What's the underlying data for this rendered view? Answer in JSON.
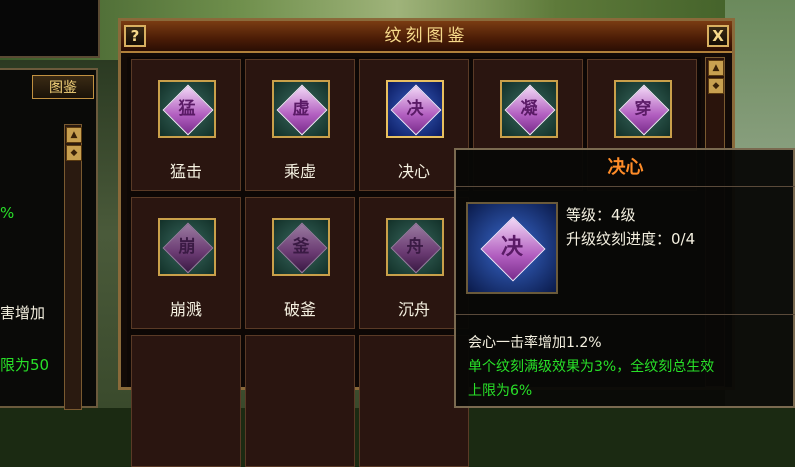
{
  "left_panel": {
    "tab_label": "图鉴",
    "text_percent": "%",
    "text_damage": "害增加",
    "text_limit": "限为50"
  },
  "window": {
    "title": "纹刻图鉴",
    "help_label": "?",
    "close_label": "X"
  },
  "cells": [
    {
      "label": "猛击",
      "glyph": "猛"
    },
    {
      "label": "乘虚",
      "glyph": "虚"
    },
    {
      "label": "决心",
      "glyph": "决"
    },
    {
      "label": "",
      "glyph": "凝"
    },
    {
      "label": "",
      "glyph": "穿"
    },
    {
      "label": "崩溅",
      "glyph": "崩"
    },
    {
      "label": "破釜",
      "glyph": "釜"
    },
    {
      "label": "沉舟",
      "glyph": "舟"
    }
  ],
  "tooltip": {
    "title": "决心",
    "glyph": "决",
    "level": "等级：4级",
    "progress": "升级纹刻进度：0/4",
    "effect": "会心一击率增加1.2%",
    "note_line1": "单个纹刻满级效果为3%，全纹刻总生效",
    "note_line2": "上限为6%"
  },
  "colors": {
    "frame_gold": "#c9a04a",
    "title_text": "#f6d98a",
    "tooltip_title": "#ff8c28",
    "green_text": "#28e028",
    "white_text": "#f4f0e0"
  }
}
